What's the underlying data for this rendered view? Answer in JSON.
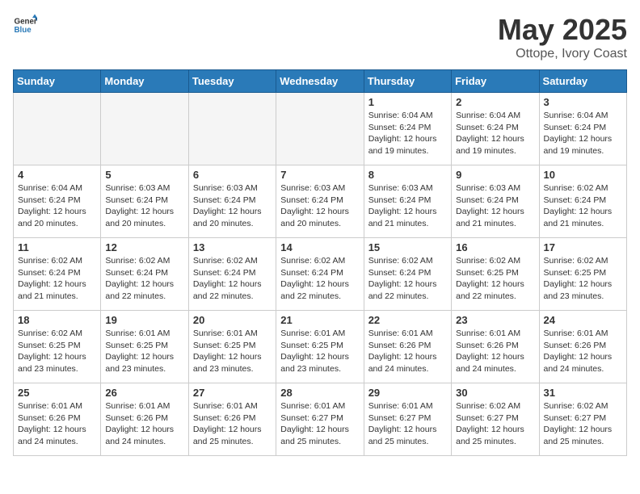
{
  "header": {
    "logo_general": "General",
    "logo_blue": "Blue",
    "month_title": "May 2025",
    "location": "Ottope, Ivory Coast"
  },
  "days_of_week": [
    "Sunday",
    "Monday",
    "Tuesday",
    "Wednesday",
    "Thursday",
    "Friday",
    "Saturday"
  ],
  "weeks": [
    [
      {
        "day": "",
        "empty": true
      },
      {
        "day": "",
        "empty": true
      },
      {
        "day": "",
        "empty": true
      },
      {
        "day": "",
        "empty": true
      },
      {
        "day": "1",
        "sunrise": "6:04 AM",
        "sunset": "6:24 PM",
        "daylight": "12 hours and 19 minutes."
      },
      {
        "day": "2",
        "sunrise": "6:04 AM",
        "sunset": "6:24 PM",
        "daylight": "12 hours and 19 minutes."
      },
      {
        "day": "3",
        "sunrise": "6:04 AM",
        "sunset": "6:24 PM",
        "daylight": "12 hours and 19 minutes."
      }
    ],
    [
      {
        "day": "4",
        "sunrise": "6:04 AM",
        "sunset": "6:24 PM",
        "daylight": "12 hours and 20 minutes."
      },
      {
        "day": "5",
        "sunrise": "6:03 AM",
        "sunset": "6:24 PM",
        "daylight": "12 hours and 20 minutes."
      },
      {
        "day": "6",
        "sunrise": "6:03 AM",
        "sunset": "6:24 PM",
        "daylight": "12 hours and 20 minutes."
      },
      {
        "day": "7",
        "sunrise": "6:03 AM",
        "sunset": "6:24 PM",
        "daylight": "12 hours and 20 minutes."
      },
      {
        "day": "8",
        "sunrise": "6:03 AM",
        "sunset": "6:24 PM",
        "daylight": "12 hours and 21 minutes."
      },
      {
        "day": "9",
        "sunrise": "6:03 AM",
        "sunset": "6:24 PM",
        "daylight": "12 hours and 21 minutes."
      },
      {
        "day": "10",
        "sunrise": "6:02 AM",
        "sunset": "6:24 PM",
        "daylight": "12 hours and 21 minutes."
      }
    ],
    [
      {
        "day": "11",
        "sunrise": "6:02 AM",
        "sunset": "6:24 PM",
        "daylight": "12 hours and 21 minutes."
      },
      {
        "day": "12",
        "sunrise": "6:02 AM",
        "sunset": "6:24 PM",
        "daylight": "12 hours and 22 minutes."
      },
      {
        "day": "13",
        "sunrise": "6:02 AM",
        "sunset": "6:24 PM",
        "daylight": "12 hours and 22 minutes."
      },
      {
        "day": "14",
        "sunrise": "6:02 AM",
        "sunset": "6:24 PM",
        "daylight": "12 hours and 22 minutes."
      },
      {
        "day": "15",
        "sunrise": "6:02 AM",
        "sunset": "6:24 PM",
        "daylight": "12 hours and 22 minutes."
      },
      {
        "day": "16",
        "sunrise": "6:02 AM",
        "sunset": "6:25 PM",
        "daylight": "12 hours and 22 minutes."
      },
      {
        "day": "17",
        "sunrise": "6:02 AM",
        "sunset": "6:25 PM",
        "daylight": "12 hours and 23 minutes."
      }
    ],
    [
      {
        "day": "18",
        "sunrise": "6:02 AM",
        "sunset": "6:25 PM",
        "daylight": "12 hours and 23 minutes."
      },
      {
        "day": "19",
        "sunrise": "6:01 AM",
        "sunset": "6:25 PM",
        "daylight": "12 hours and 23 minutes."
      },
      {
        "day": "20",
        "sunrise": "6:01 AM",
        "sunset": "6:25 PM",
        "daylight": "12 hours and 23 minutes."
      },
      {
        "day": "21",
        "sunrise": "6:01 AM",
        "sunset": "6:25 PM",
        "daylight": "12 hours and 23 minutes."
      },
      {
        "day": "22",
        "sunrise": "6:01 AM",
        "sunset": "6:26 PM",
        "daylight": "12 hours and 24 minutes."
      },
      {
        "day": "23",
        "sunrise": "6:01 AM",
        "sunset": "6:26 PM",
        "daylight": "12 hours and 24 minutes."
      },
      {
        "day": "24",
        "sunrise": "6:01 AM",
        "sunset": "6:26 PM",
        "daylight": "12 hours and 24 minutes."
      }
    ],
    [
      {
        "day": "25",
        "sunrise": "6:01 AM",
        "sunset": "6:26 PM",
        "daylight": "12 hours and 24 minutes."
      },
      {
        "day": "26",
        "sunrise": "6:01 AM",
        "sunset": "6:26 PM",
        "daylight": "12 hours and 24 minutes."
      },
      {
        "day": "27",
        "sunrise": "6:01 AM",
        "sunset": "6:26 PM",
        "daylight": "12 hours and 25 minutes."
      },
      {
        "day": "28",
        "sunrise": "6:01 AM",
        "sunset": "6:27 PM",
        "daylight": "12 hours and 25 minutes."
      },
      {
        "day": "29",
        "sunrise": "6:01 AM",
        "sunset": "6:27 PM",
        "daylight": "12 hours and 25 minutes."
      },
      {
        "day": "30",
        "sunrise": "6:02 AM",
        "sunset": "6:27 PM",
        "daylight": "12 hours and 25 minutes."
      },
      {
        "day": "31",
        "sunrise": "6:02 AM",
        "sunset": "6:27 PM",
        "daylight": "12 hours and 25 minutes."
      }
    ]
  ]
}
